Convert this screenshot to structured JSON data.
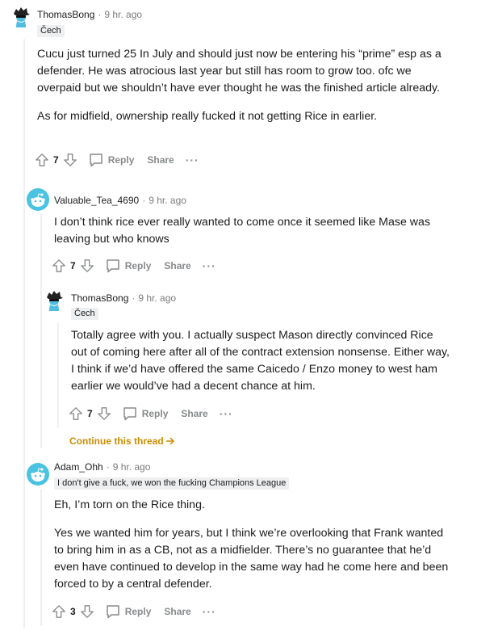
{
  "comments": [
    {
      "username": "ThomasBong",
      "time": "9 hr. ago",
      "flair": "Čech",
      "paragraphs": [
        "Cucu just turned 25 In July and should just now be entering his “prime” esp as a defender. He was atrocious last year but still has room to grow too. ofc we overpaid but we shouldn’t have ever thought he was the finished article already.",
        "As for midfield, ownership really fucked it not getting Rice in earlier."
      ],
      "score": "7",
      "reply_label": "Reply",
      "share_label": "Share",
      "more_label": "···"
    },
    {
      "username": "Valuable_Tea_4690",
      "time": "9 hr. ago",
      "paragraphs": [
        "I don’t think rice ever really wanted to come once it seemed like Mase was leaving but who knows"
      ],
      "score": "7",
      "reply_label": "Reply",
      "share_label": "Share",
      "more_label": "···"
    },
    {
      "username": "ThomasBong",
      "time": "9 hr. ago",
      "flair": "Čech",
      "paragraphs": [
        "Totally agree with you. I actually suspect Mason directly convinced Rice out of coming here after all of the contract extension nonsense. Either way, I think if we’d have offered the same Caicedo / Enzo money to west ham earlier we would’ve had a decent chance at him."
      ],
      "score": "7",
      "reply_label": "Reply",
      "share_label": "Share",
      "more_label": "···",
      "continue_label": "Continue this thread"
    },
    {
      "username": "Adam_Ohh",
      "time": "9 hr. ago",
      "flair": "I don't give a fuck, we won the fucking Champions League",
      "paragraphs": [
        "Eh, I’m torn on the Rice thing.",
        "Yes we wanted him for years, but I think we’re overlooking that Frank wanted to bring him in as a CB, not as a midfielder. There’s no guarantee that he’d even have continued to develop in the same way had he come here and been forced to by a central defender."
      ],
      "score": "3",
      "reply_label": "Reply",
      "share_label": "Share",
      "more_label": "···"
    }
  ],
  "colors": {
    "meta": "#7c7c7c",
    "action": "#878a8c",
    "thread_line": "#edeff1",
    "continue_link": "#cc8d00",
    "avatar_blue": "#4fbde0",
    "avatar_teal": "#49c3e1"
  },
  "icons": {
    "upvote": "arrow-up-outline-icon",
    "downvote": "arrow-down-outline-icon",
    "reply": "speech-bubble-icon",
    "more": "ellipsis-icon",
    "continue": "arrow-right-icon"
  }
}
